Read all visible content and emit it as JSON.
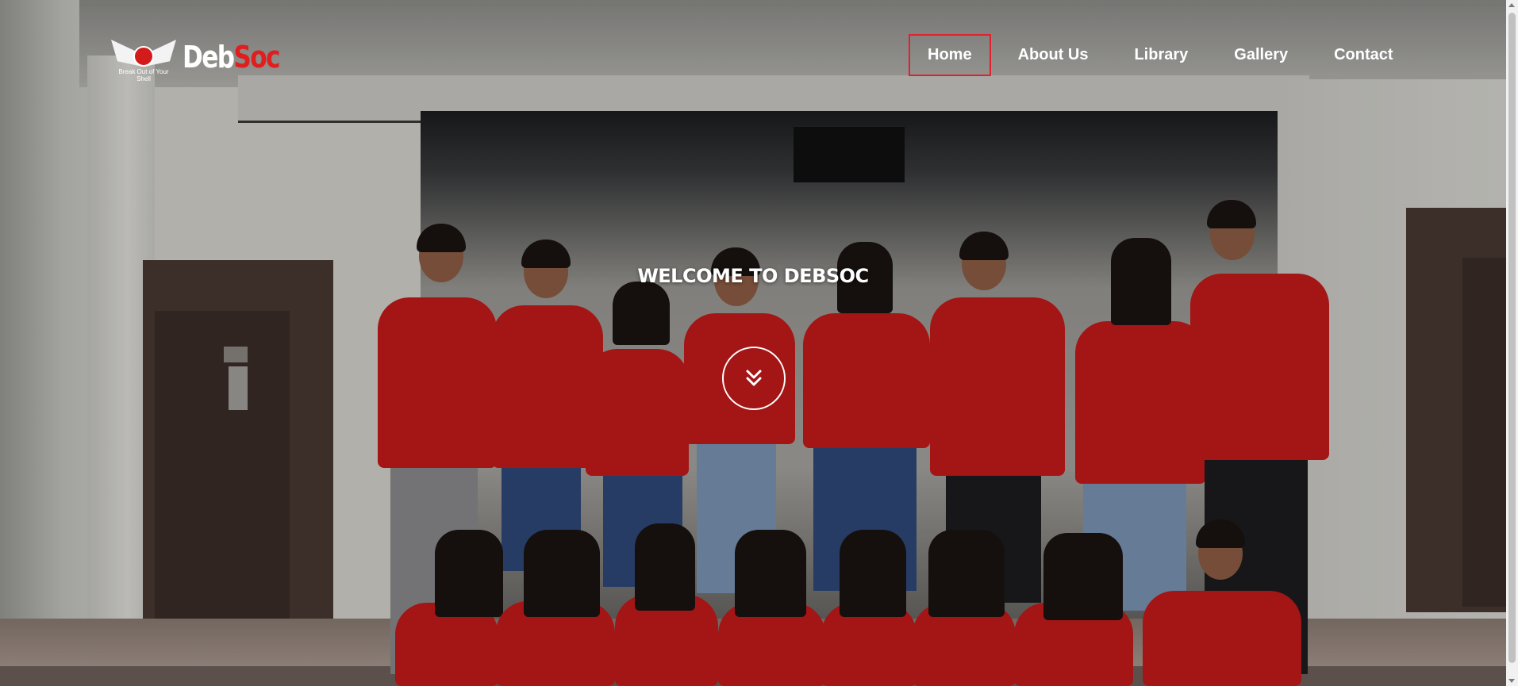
{
  "brand": {
    "name_part1": "Deb",
    "name_part2": "Soc",
    "logo_top_text": "DEBSOC",
    "logo_tagline": "Break Out of Your Shell",
    "accent_color": "#e01e1e"
  },
  "nav": {
    "items": [
      {
        "label": "Home",
        "active": true
      },
      {
        "label": "About Us",
        "active": false
      },
      {
        "label": "Library",
        "active": false
      },
      {
        "label": "Gallery",
        "active": false
      },
      {
        "label": "Contact",
        "active": false
      }
    ],
    "active_border_color": "#e0222e"
  },
  "hero": {
    "heading": "WELCOME TO DEBSOC",
    "scroll_icon": "double-chevron-down-icon"
  }
}
